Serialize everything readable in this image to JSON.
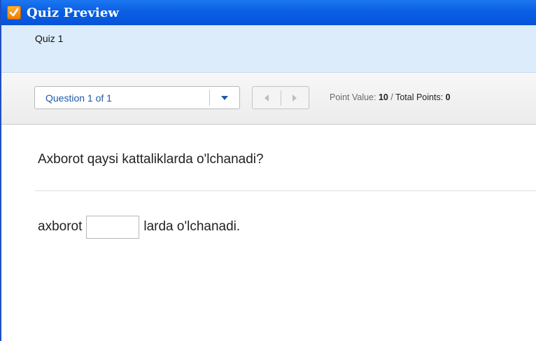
{
  "window": {
    "title": "Quiz Preview",
    "icon": "checkbox-logo-icon"
  },
  "quiz": {
    "name": "Quiz 1"
  },
  "toolbar": {
    "question_selector": "Question 1 of 1",
    "point_value_label": "Point Value:",
    "point_value": "10",
    "separator": "/",
    "total_points_label": "Total Points:",
    "total_points": "0"
  },
  "question": {
    "text": "Axborot qaysi kattaliklarda o'lchanadi?",
    "answer_prefix": "axborot",
    "answer_value": "",
    "answer_suffix": "larda o'lchanadi."
  },
  "colors": {
    "titlebar": "#0a5fe4",
    "quizbar": "#dcecfb",
    "link_blue": "#1d5aa8",
    "accent_orange": "#f07b00"
  }
}
